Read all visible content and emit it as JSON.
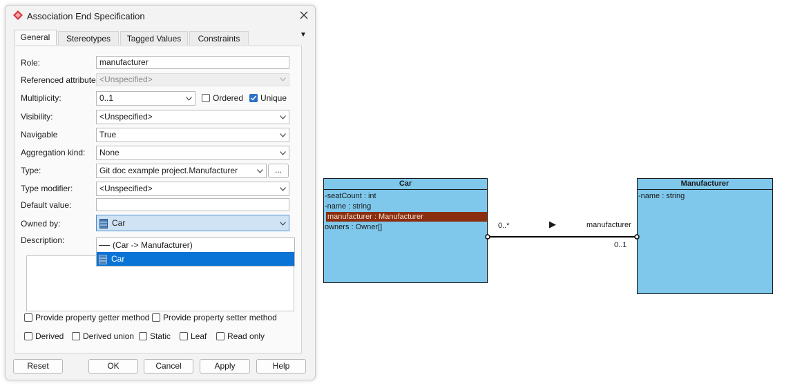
{
  "dialog": {
    "title": "Association End Specification",
    "tabs": [
      {
        "label": "General",
        "active": true
      },
      {
        "label": "Stereotypes",
        "active": false
      },
      {
        "label": "Tagged Values",
        "active": false
      },
      {
        "label": "Constraints",
        "active": false
      }
    ],
    "fields": {
      "role_label": "Role:",
      "role_value": "manufacturer",
      "ref_attr_label": "Referenced attribute:",
      "ref_attr_value": "<Unspecified>",
      "multiplicity_label": "Multiplicity:",
      "multiplicity_value": "0..1",
      "ordered_label": "Ordered",
      "ordered_checked": false,
      "unique_label": "Unique",
      "unique_checked": true,
      "visibility_label": "Visibility:",
      "visibility_value": "<Unspecified>",
      "navigable_label": "Navigable",
      "navigable_value": "True",
      "aggregation_label": "Aggregation kind:",
      "aggregation_value": "None",
      "type_label": "Type:",
      "type_value": "Git doc example project.Manufacturer",
      "type_browse": "...",
      "type_modifier_label": "Type modifier:",
      "type_modifier_value": "<Unspecified>",
      "default_value_label": "Default value:",
      "default_value": "",
      "owned_by_label": "Owned by:",
      "owned_by_value": "Car",
      "description_label": "Description:"
    },
    "owned_by_options": [
      {
        "label": "(Car -> Manufacturer)",
        "kind": "association",
        "selected": false
      },
      {
        "label": "Car",
        "kind": "class",
        "selected": true
      }
    ],
    "checkboxes_row1": [
      {
        "label": "Provide property getter method",
        "checked": false
      },
      {
        "label": "Provide property setter method",
        "checked": false
      }
    ],
    "checkboxes_row2": [
      {
        "label": "Derived",
        "checked": false
      },
      {
        "label": "Derived union",
        "checked": false
      },
      {
        "label": "Static",
        "checked": false
      },
      {
        "label": "Leaf",
        "checked": false
      },
      {
        "label": "Read only",
        "checked": false
      }
    ],
    "buttons": {
      "reset": "Reset",
      "ok": "OK",
      "cancel": "Cancel",
      "apply": "Apply",
      "help": "Help"
    },
    "tab_overflow": "▼"
  },
  "diagram": {
    "car": {
      "name": "Car",
      "attributes": [
        {
          "text": "-seatCount : int",
          "selected": false
        },
        {
          "text": "-name : string",
          "selected": false
        },
        {
          "text": " manufacturer : Manufacturer",
          "selected": true
        },
        {
          "text": " owners : Owner[]",
          "selected": false
        }
      ]
    },
    "manufacturer": {
      "name": "Manufacturer",
      "attributes": [
        {
          "text": "-name : string",
          "selected": false
        }
      ]
    },
    "association": {
      "source_multiplicity": "0..*",
      "target_role": "manufacturer",
      "target_multiplicity": "0..1",
      "direction_glyph": "▶"
    }
  },
  "colors": {
    "class_fill": "#7fc8ec",
    "selected_attr": "#8b2e0f",
    "accent": "#0a73d6",
    "checkbox_on": "#2a6fc9"
  }
}
